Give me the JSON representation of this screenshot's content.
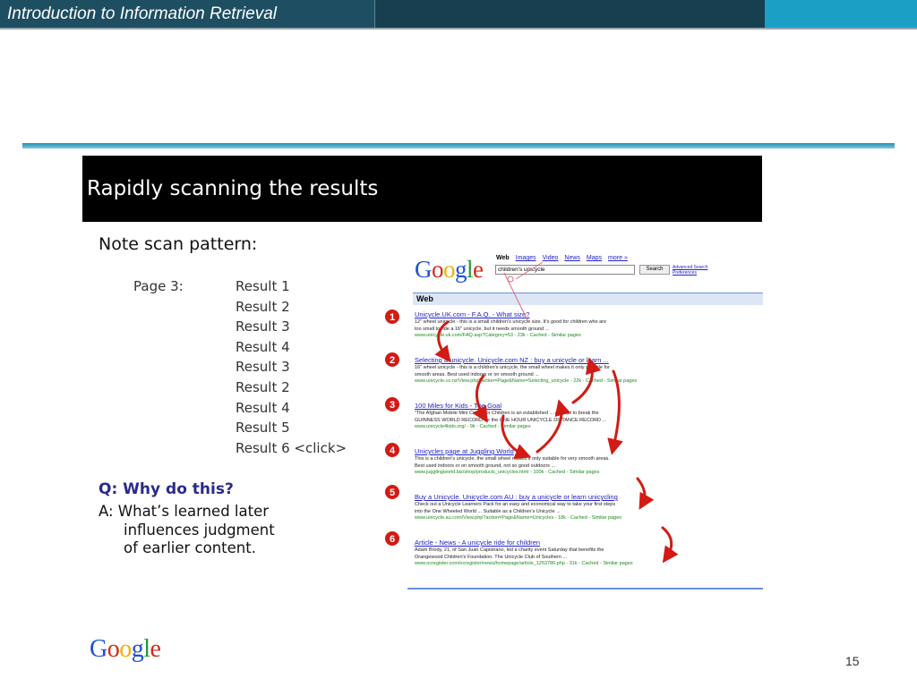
{
  "header": {
    "course_title": "Introduction to Information Retrieval"
  },
  "slide": {
    "heading": "Rapidly scanning the results",
    "note": "Note scan pattern:",
    "page_label": "Page 3:",
    "results": [
      "Result 1",
      "Result 2",
      "Result 3",
      "Result 4",
      "Result 3",
      "Result 2",
      "Result 4",
      "Result 5",
      "Result 6  <click>"
    ],
    "question": "Q: Why do this?",
    "answer_lines": [
      "A:  What’s learned later",
      "influences judgment",
      "of earlier content."
    ]
  },
  "screenshot": {
    "logo": "Google",
    "nav_tabs": [
      "Web",
      "Images",
      "Video",
      "News",
      "Maps",
      "more »"
    ],
    "search_value": "children's unicycle",
    "search_button": "Search",
    "advanced_links": "Advanced Search Preferences",
    "web_label": "Web",
    "results": [
      {
        "number": "1",
        "title": "Unicycle.UK.com - F.A.Q. - What size?",
        "snippet1": "12\" wheel unicycle - this is a small children's unicycle size. It's good for children who are",
        "snippet2": "too small to ride a 16\" unicycle, but it needs smooth ground ...",
        "url": "www.unicycle.uk.com/FAQ.asp?Category=53 - 23k - Cached - Similar pages"
      },
      {
        "number": "2",
        "title": "Selecting a unicycle. Unicycle.com NZ : buy a unicycle or learn ...",
        "snippet1": "16\" wheel unicycle - this is a children's unicycle, the small wheel makes it only suitable for",
        "snippet2": "smooth areas. Best used indoors or on smooth ground ...",
        "url": "www.unicycle.co.nz/View.php?action=Page&Name=Selecting_unicycle - 22k - Cached - Similar pages"
      },
      {
        "number": "3",
        "title": "100 Miles for Kids - The Goal",
        "snippet1": "\"The Afghan Mobile Mini Circus for Children is an established ... attempt to break the",
        "snippet2": "GUINNESS WORLD RECORD for the ONE HOUR UNICYCLE DISTANCE RECORD ...",
        "url": "www.unicycle4kids.org/ - 9k - Cached - Similar pages"
      },
      {
        "number": "4",
        "title": "Unicycles page at Juggling World",
        "snippet1": "This is a children's unicycle, the small wheel makes it only suitable for very smooth areas.",
        "snippet2": "Best used indoors or on smooth ground, not so good outdoors ...",
        "url": "www.jugglingworld.biz/shop/products_unicycles.html - 100k - Cached - Similar pages"
      },
      {
        "number": "5",
        "title": "Buy a Unicycle. Unicycle.com AU : buy a unicycle or learn unicycling",
        "snippet1": "Check out a Unicycle Learners Pack for an easy and economical way to take your first steps",
        "snippet2": "into the One Wheeled World ... Suitable as a Children's Unicycle ...",
        "url": "www.unicycle.au.com/View.php?action=Page&Name=Unicycles - 18k - Cached - Similar pages"
      },
      {
        "number": "6",
        "title": "Article - News - A unicycle ride for children",
        "snippet1": "Adam Brody, 21, of San Juan Capistrano, led a charity event Saturday that benefits the",
        "snippet2": "Orangewood Children's Foundation. The Unicycle Club of Southern ...",
        "url": "www.ocregister.com/ocregister/news/homepage/article_1253786.php - 31k - Cached - Similar pages"
      }
    ]
  },
  "footer": {
    "logo": "Google",
    "page_number": "15"
  },
  "colors": {
    "header_bar": "#1e4e62",
    "header_accent": "#1c9fc4",
    "question": "#2a2a8c",
    "annotation": "#d11b14",
    "link": "#2020cc",
    "url_green": "#1a8a1a"
  }
}
